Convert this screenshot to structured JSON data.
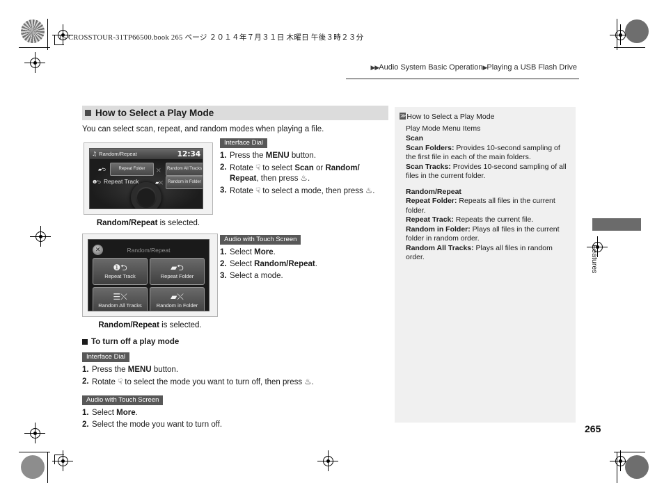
{
  "print_meta": {
    "line": "15 CROSSTOUR-31TP66500.book   265 ページ   ２０１４年７月３１日   木曜日   午後３時２３分"
  },
  "breadcrumb": {
    "arrow_double": "▶▶",
    "arrow_single": "▶",
    "section": "Audio System Basic Operation",
    "page_topic": "Playing a USB Flash Drive"
  },
  "main": {
    "heading": "How to Select a Play Mode",
    "intro": "You can select scan, repeat, and random modes when playing a file.",
    "screen_dial": {
      "title": "Random/Repeat",
      "note_icon": "♫",
      "clock": "12:34",
      "buttons": {
        "repeat_folder": "Repeat Folder",
        "random_all_tracks": "Random All Tracks",
        "repeat_track": "Repeat Track",
        "random_in_folder": "Random in Folder"
      },
      "caption_bold": "Random/Repeat",
      "caption_rest": " is selected."
    },
    "screen_touch": {
      "title": "Random/Repeat",
      "close_icon": "✕",
      "tiles": [
        {
          "icon": "❶⮌",
          "label": "Repeat Track",
          "icon_name": "repeat-track-icon"
        },
        {
          "icon": "▰⮌",
          "label": "Repeat Folder",
          "icon_name": "repeat-folder-icon"
        },
        {
          "icon": "☰⤬",
          "label": "Random All Tracks",
          "icon_name": "random-all-tracks-icon"
        },
        {
          "icon": "▰⤬",
          "label": "Random in Folder",
          "icon_name": "random-in-folder-icon"
        }
      ],
      "caption_bold": "Random/Repeat",
      "caption_rest": " is selected."
    },
    "dial_block": {
      "tag": "Interface Dial",
      "steps": [
        {
          "n": "1.",
          "pre": "Press the ",
          "bold": "MENU",
          "post": " button."
        },
        {
          "n": "2.",
          "pre": "Rotate ",
          "glyph1": "☟",
          "mid": " to select ",
          "bold": "Scan",
          "mid2": " or ",
          "bold2": "Random/ Repeat",
          "post": ", then press ",
          "glyph2": "♨",
          "end": "."
        },
        {
          "n": "3.",
          "pre": "Rotate ",
          "glyph1": "☟",
          "mid": " to select a mode, then press ",
          "glyph2": "♨",
          "end": "."
        }
      ]
    },
    "touch_block": {
      "tag": "Audio with Touch Screen",
      "steps": [
        {
          "n": "1.",
          "pre": "Select ",
          "bold": "More",
          "post": "."
        },
        {
          "n": "2.",
          "pre": "Select ",
          "bold": "Random/Repeat",
          "post": "."
        },
        {
          "n": "3.",
          "pre": "Select a mode.",
          "bold": "",
          "post": ""
        }
      ]
    },
    "turnoff": {
      "heading": "To turn off a play mode",
      "dial_tag": "Interface Dial",
      "dial_steps": [
        {
          "n": "1.",
          "pre": "Press the ",
          "bold": "MENU",
          "post": " button."
        },
        {
          "n": "2.",
          "pre": "Rotate ",
          "glyph1": "☟",
          "mid": " to select the mode you want to turn off, then press ",
          "glyph2": "♨",
          "end": "."
        }
      ],
      "touch_tag": "Audio with Touch Screen",
      "touch_steps": [
        {
          "n": "1.",
          "pre": "Select ",
          "bold": "More",
          "post": "."
        },
        {
          "n": "2.",
          "pre": "Select the mode you want to turn off.",
          "bold": "",
          "post": ""
        }
      ]
    }
  },
  "sidebar": {
    "ref_icon": "≫",
    "title": "How to Select a Play Mode",
    "subtitle": "Play Mode Menu Items",
    "groups": [
      {
        "heading": "Scan",
        "entries": [
          {
            "term": "Scan Folders:",
            "desc": " Provides 10-second sampling of the first file in each of the main folders."
          },
          {
            "term": "Scan Tracks:",
            "desc": " Provides 10-second sampling of all files in the current folder."
          }
        ]
      },
      {
        "heading": "Random/Repeat",
        "entries": [
          {
            "term": "Repeat Folder:",
            "desc": " Repeats all files in the current folder."
          },
          {
            "term": "Repeat Track:",
            "desc": " Repeats the current file."
          },
          {
            "term": "Random in Folder:",
            "desc": " Plays all files in the current folder in random order."
          },
          {
            "term": "Random All Tracks:",
            "desc": " Plays all files in random order."
          }
        ]
      }
    ]
  },
  "edge_tab": {
    "label": "Features"
  },
  "page_number": "265",
  "colors": {
    "section_header_bg": "#dcdcdc",
    "tag_bg": "#585858",
    "sidebar_bg": "#f0f0f0",
    "edge_tab_bg": "#6b6b6b"
  }
}
